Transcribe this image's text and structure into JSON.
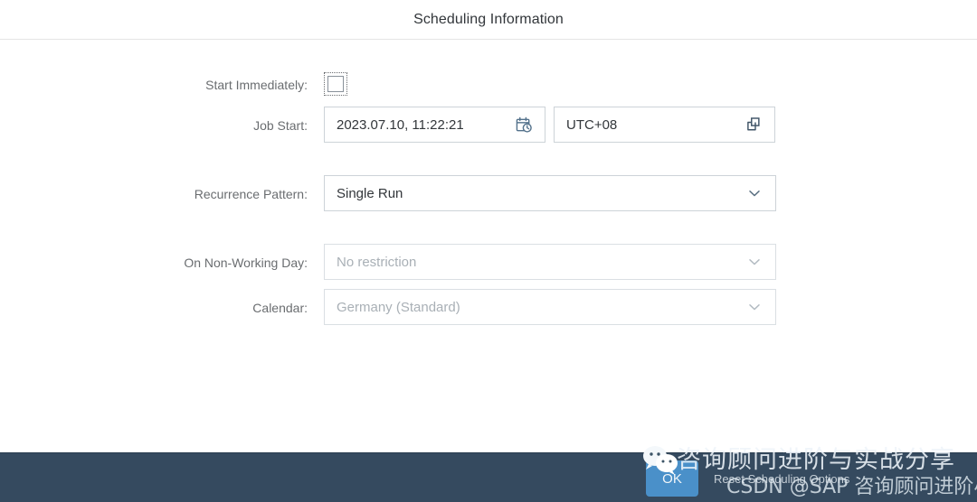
{
  "header": {
    "title": "Scheduling Information"
  },
  "form": {
    "start_immediately": {
      "label": "Start Immediately:",
      "checked": false,
      "icon": "checkbox-unchecked-icon"
    },
    "job_start": {
      "label": "Job Start:",
      "value": "2023.07.10, 11:22:21",
      "placeholder": "",
      "icon": "calendar-clock-icon"
    },
    "timezone": {
      "label": "",
      "value": "UTC+08",
      "placeholder": "",
      "icon": "value-help-icon"
    },
    "recurrence_pattern": {
      "label": "Recurrence Pattern:",
      "value": "Single Run",
      "icon": "chevron-down-icon",
      "disabled": false
    },
    "on_non_working_day": {
      "label": "On Non-Working Day:",
      "value": "No restriction",
      "icon": "chevron-down-icon",
      "disabled": true
    },
    "calendar": {
      "label": "Calendar:",
      "value": "Germany (Standard)",
      "icon": "chevron-down-icon",
      "disabled": true
    }
  },
  "footer": {
    "ok_label": "OK",
    "reset_label": "Reset Scheduling Options",
    "bar_color": "#354a5f",
    "ok_color": "#4a90c9"
  },
  "watermark": {
    "logo": "wechat-icon",
    "line1": "咨询顾问进阶与实战分享",
    "line2": "CSDN @SAP 咨询顾问进阶小陈"
  }
}
